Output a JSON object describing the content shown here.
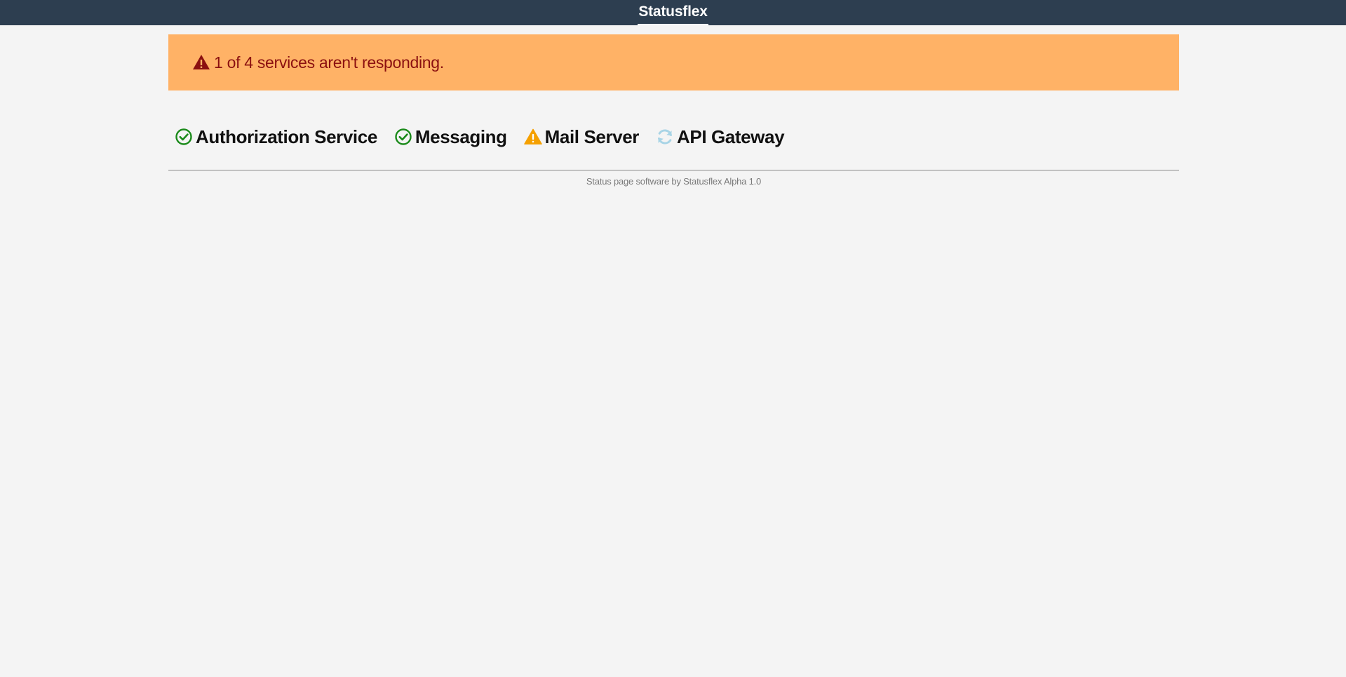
{
  "header": {
    "title": "Statusflex"
  },
  "alert": {
    "icon": "warning-triangle-icon",
    "text": "1 of 4 services aren't responding.",
    "background": "#ffb266",
    "text_color": "#8b1010"
  },
  "services": [
    {
      "name": "Authorization Service",
      "status": "ok",
      "icon": "check-circle-icon",
      "color": "#1a8a1a"
    },
    {
      "name": "Messaging",
      "status": "ok",
      "icon": "check-circle-icon",
      "color": "#1a8a1a"
    },
    {
      "name": "Mail Server",
      "status": "warning",
      "icon": "warning-triangle-icon",
      "color": "#f5a000"
    },
    {
      "name": "API Gateway",
      "status": "checking",
      "icon": "refresh-icon",
      "color": "#a8d4e6"
    }
  ],
  "footer": {
    "text": "Status page software by Statusflex Alpha 1.0"
  }
}
